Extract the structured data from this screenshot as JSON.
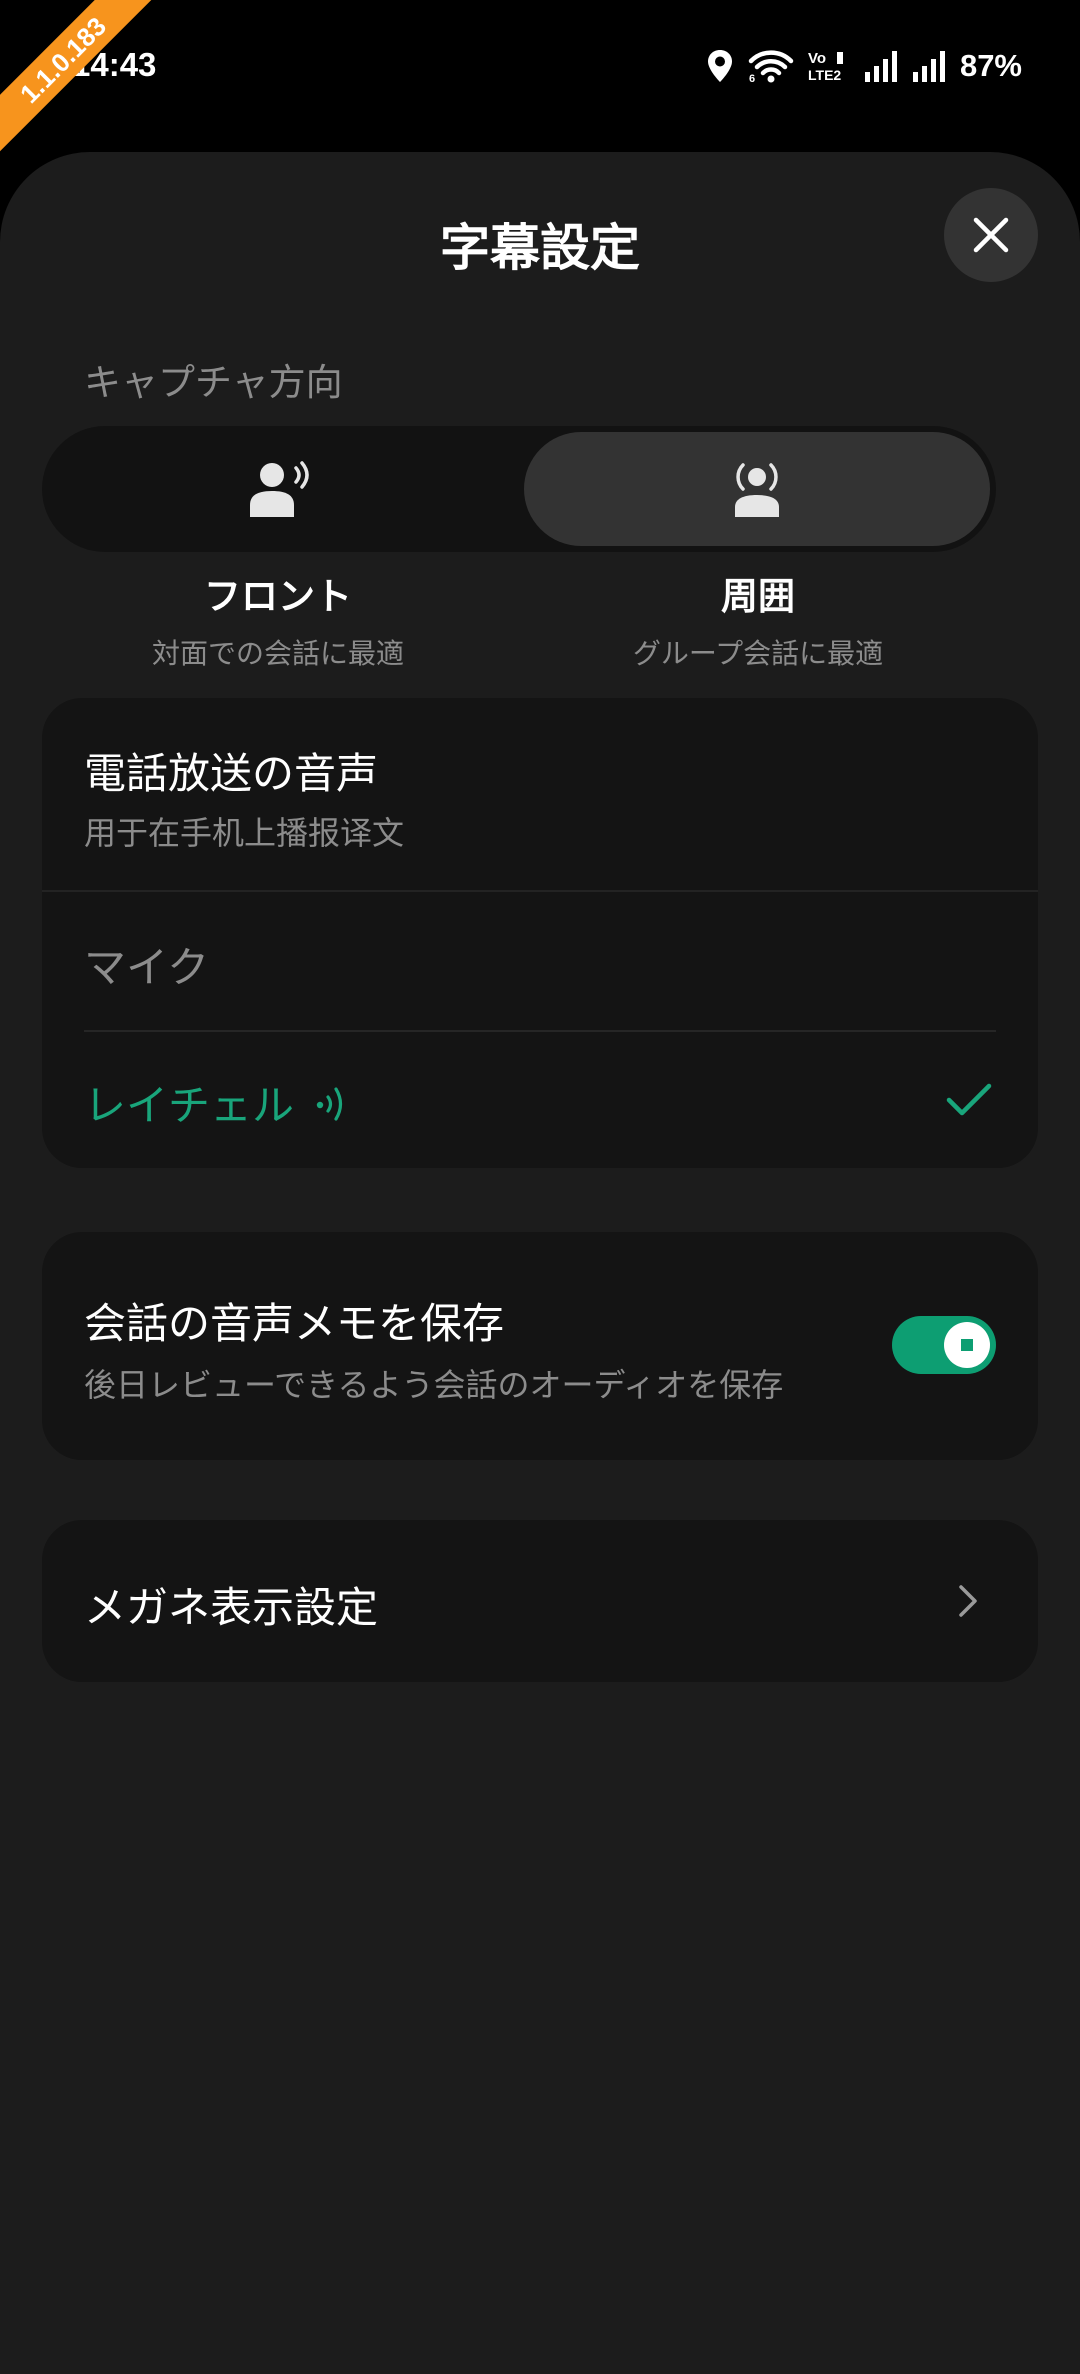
{
  "status_bar": {
    "time": "14:43",
    "battery": "87%",
    "icons": [
      "location-icon",
      "wifi-icon",
      "volte-icon",
      "signal-icon",
      "signal-icon"
    ]
  },
  "debug_ribbon": "1.1.0.183",
  "sheet": {
    "title": "字幕設定",
    "close_icon": "close-icon"
  },
  "capture": {
    "label": "キャプチャ方向",
    "options": [
      {
        "title": "フロント",
        "subtitle": "対面での会話に最適",
        "icon": "person-speaking-icon",
        "selected": false
      },
      {
        "title": "周囲",
        "subtitle": "グループ会話に最適",
        "icon": "person-surround-icon",
        "selected": true
      }
    ]
  },
  "audio_card": {
    "title": "電話放送の音声",
    "subtitle": "用于在手机上播报译文",
    "options": [
      {
        "label": "マイク",
        "selected": false
      },
      {
        "label": "レイチェル",
        "selected": true,
        "icon": "sound-wave-icon",
        "check_icon": "check-icon"
      }
    ]
  },
  "memo_card": {
    "title": "会話の音声メモを保存",
    "subtitle": "後日レビューできるよう会話のオーディオを保存",
    "toggle_on": true
  },
  "glasses_card": {
    "title": "メガネ表示設定",
    "icon": "chevron-right-icon"
  },
  "colors": {
    "accent": "#19a57b",
    "toggle": "#0d9e72",
    "sheet_bg": "#1c1c1c",
    "card_bg": "#141414",
    "ribbon": "#f7941d"
  }
}
